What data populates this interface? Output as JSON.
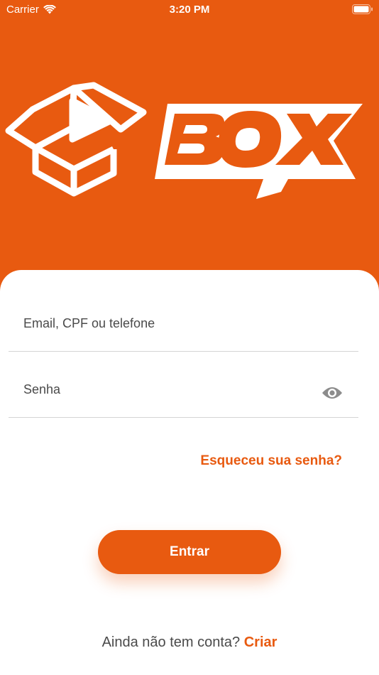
{
  "colors": {
    "brand": "#e85a10",
    "text": "#4a4a4a",
    "divider": "#d4d4d4"
  },
  "status_bar": {
    "carrier": "Carrier",
    "time": "3:20 PM",
    "wifi_icon": "wifi-icon",
    "battery_icon": "battery-icon"
  },
  "brand": {
    "logo_icon": "box-logo-icon",
    "wordmark": "BOX"
  },
  "login": {
    "identifier_placeholder": "Email, CPF ou telefone",
    "password_placeholder": "Senha",
    "password_toggle_icon": "eye-icon",
    "forgot_password": "Esqueceu sua senha?",
    "submit_label": "Entrar"
  },
  "signup": {
    "prompt": "Ainda não tem conta?",
    "link": "Criar"
  }
}
